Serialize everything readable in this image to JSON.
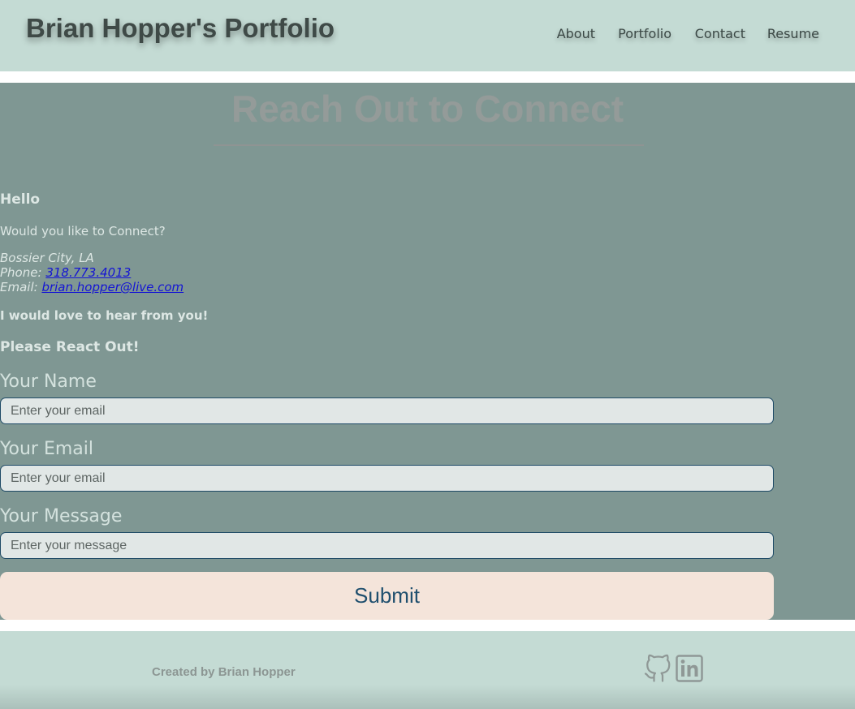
{
  "header": {
    "site_title": "Brian Hopper's Portfolio",
    "nav": [
      {
        "label": "About"
      },
      {
        "label": "Portfolio"
      },
      {
        "label": "Contact"
      },
      {
        "label": "Resume"
      }
    ]
  },
  "main": {
    "heading": "Reach Out to Connect",
    "greeting": "Hello",
    "question": "Would you like to Connect?",
    "location": "Bossier City, LA",
    "phone_label": "Phone:",
    "phone": "318.773.4013",
    "email_label": "Email:",
    "email": "brian.hopper@live.com",
    "love_text": "I would love to hear from you!",
    "reach_text": "Please React Out!"
  },
  "form": {
    "name_label": "Your Name",
    "name_placeholder": "Enter your email",
    "email_label": "Your Email",
    "email_placeholder": "Enter your email",
    "message_label": "Your Message",
    "message_placeholder": "Enter your message",
    "submit_label": "Submit"
  },
  "footer": {
    "credit": "Created by Brian Hopper",
    "social": [
      {
        "icon": "github-icon"
      },
      {
        "icon": "linkedin-icon"
      }
    ]
  },
  "colors": {
    "header_bg": "#c4dbd4",
    "main_bg": "#7f9793",
    "input_bg": "#e1e7e6",
    "button_bg": "#f4e4da",
    "button_text": "#1f4f6e",
    "link": "#1414d4"
  }
}
